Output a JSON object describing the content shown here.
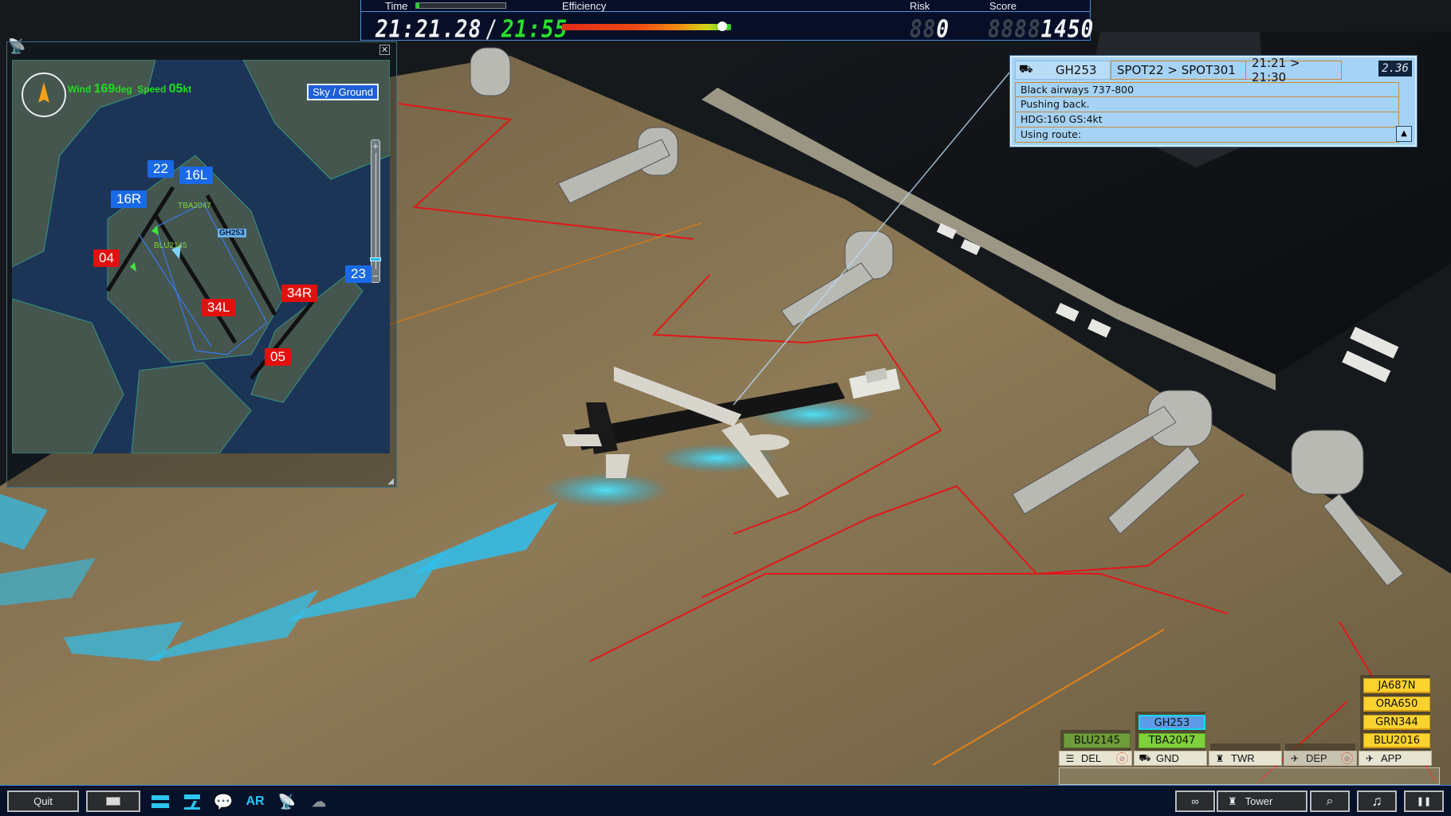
{
  "hud": {
    "time_label": "Time",
    "time_progress": 0.04,
    "clock_ghost": "88:88.88",
    "clock": "21:21.28",
    "clock_separator": "/",
    "clock_limit": "21:55",
    "efficiency_label": "Efficiency",
    "efficiency": 0.95,
    "risk_label": "Risk",
    "risk_ghost": "88",
    "risk": "0",
    "score_label": "Score",
    "score_ghost": "8888",
    "score": "1450"
  },
  "minimap": {
    "close_icon": "close-icon",
    "compass_icon": "compass-north-arrow-icon",
    "wind_label": "Wind",
    "wind_deg": "169",
    "wind_deg_unit": "deg",
    "speed_label": "Speed",
    "speed": "05",
    "speed_unit": "kt",
    "view_toggle": "Sky / Ground",
    "zoom_plus": "+",
    "zoom_minus": "−",
    "zoom_level": 0.9,
    "runways": [
      {
        "id": "22",
        "color": "blue"
      },
      {
        "id": "16L",
        "color": "blue"
      },
      {
        "id": "16R",
        "color": "blue"
      },
      {
        "id": "23",
        "color": "blue"
      },
      {
        "id": "04",
        "color": "red"
      },
      {
        "id": "34R",
        "color": "red"
      },
      {
        "id": "34L",
        "color": "red"
      },
      {
        "id": "05",
        "color": "red"
      }
    ],
    "aircraft": [
      {
        "callsign": "TBA2047",
        "state": "normal"
      },
      {
        "callsign": "GH253",
        "state": "selected"
      },
      {
        "callsign": "BLU2145",
        "state": "normal"
      }
    ]
  },
  "info_panel": {
    "callsign": "GH253",
    "route": "SPOT22 > SPOT301",
    "times": "21:21 > 21:30",
    "timer": "2.36",
    "lines": [
      "Black airways 737-800",
      "Pushing back.",
      "HDG:160 GS:4kt",
      "Using route:"
    ],
    "collapse_glyph": "▲"
  },
  "strip_bay": {
    "positions": [
      {
        "id": "del",
        "label": "DEL",
        "icon": "☰",
        "enabled": true,
        "muted": true,
        "strips": [
          {
            "callsign": "BLU2145",
            "style": "green-dark"
          }
        ]
      },
      {
        "id": "gnd",
        "label": "GND",
        "icon": "⛟",
        "enabled": true,
        "muted": false,
        "strips": [
          {
            "callsign": "GH253",
            "style": "blue"
          },
          {
            "callsign": "TBA2047",
            "style": "green"
          }
        ]
      },
      {
        "id": "twr",
        "label": "TWR",
        "icon": "♜",
        "enabled": true,
        "muted": false,
        "strips": []
      },
      {
        "id": "dep",
        "label": "DEP",
        "icon": "✈",
        "enabled": false,
        "muted": true,
        "strips": []
      },
      {
        "id": "app",
        "label": "APP",
        "icon": "✈",
        "enabled": true,
        "muted": false,
        "strips": [
          {
            "callsign": "JA687N",
            "style": "yellow"
          },
          {
            "callsign": "ORA650",
            "style": "yellow"
          },
          {
            "callsign": "GRN344",
            "style": "yellow"
          },
          {
            "callsign": "BLU2016",
            "style": "yellow"
          }
        ]
      }
    ],
    "command_input": ""
  },
  "toolbar": {
    "quit": "Quit",
    "ar_label": "AR",
    "tower": "Tower",
    "pause_glyph": "❚❚",
    "music_glyph": "♫",
    "search_glyph": "⌕"
  },
  "colors": {
    "hud_border": "#4a8fd8",
    "accent_cyan": "#2bc6f2",
    "runway_blue": "#1a6ae8",
    "runway_red": "#e0110e",
    "strip_yellow": "#fcd22e",
    "strip_green": "#7fd03a",
    "strip_blue": "#5d9be8",
    "wind_green": "#22dd22"
  }
}
